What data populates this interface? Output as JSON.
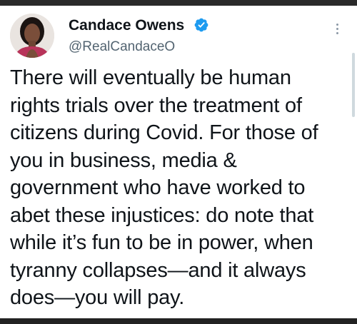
{
  "author": {
    "display_name": "Candace Owens",
    "handle": "@RealCandaceO",
    "verified": true
  },
  "tweet": {
    "lines": [
      "There will eventually be human",
      "rights trials over the treatment of",
      "citizens during Covid. For those of",
      "you in business, media &",
      "government who have worked to",
      "abet these injustices: do note that",
      "while it’s fun to be in power, when",
      "tyranny collapses—and it always",
      "does—you will pay."
    ]
  },
  "icons": {
    "verified": "verified-badge-icon",
    "more": "more-options-icon"
  },
  "colors": {
    "text": "#0f1419",
    "secondary_text": "#536471",
    "verified_blue": "#1d9bf0",
    "background": "#ffffff"
  }
}
